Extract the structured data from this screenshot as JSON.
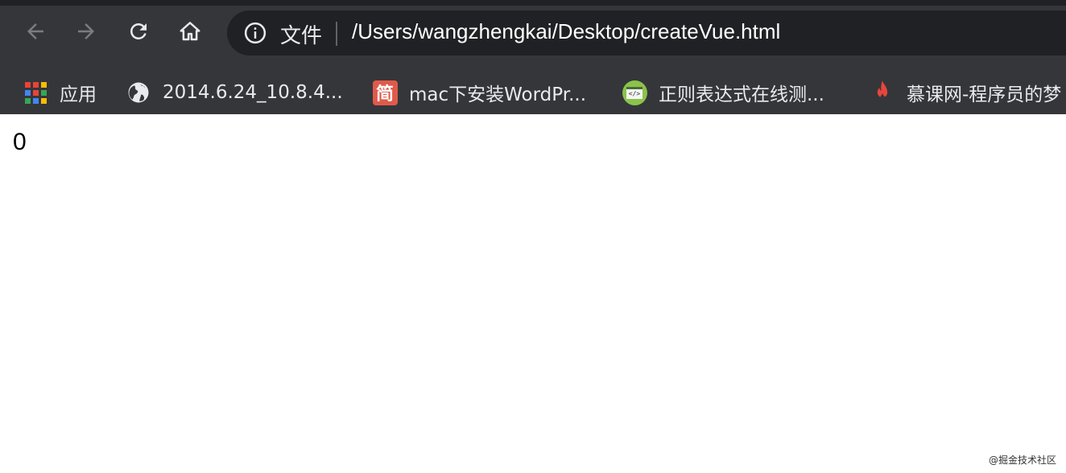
{
  "toolbar": {
    "scheme_label": "文件",
    "url": "/Users/wangzhengkai/Desktop/createVue.html"
  },
  "bookmarks": [
    {
      "label": "应用",
      "icon": "apps-grid-icon"
    },
    {
      "label": "2014.6.24_10.8.4...",
      "icon": "globe-icon"
    },
    {
      "label": "mac下安装WordPr...",
      "icon": "jianshu-icon",
      "icon_text": "简"
    },
    {
      "label": "正则表达式在线测...",
      "icon": "regex-tool-icon",
      "icon_text": "</>"
    },
    {
      "label": "慕课网-程序员的梦",
      "icon": "flame-icon"
    }
  ],
  "page": {
    "content": "0"
  },
  "watermark": "@掘金技术社区",
  "colors": {
    "chrome_bg": "#35363a",
    "omnibox_bg": "#202124",
    "text": "#e8eaed",
    "jianshu_red": "#e05a4a",
    "regex_green": "#8bc34a",
    "flame_red": "#e8453c"
  }
}
